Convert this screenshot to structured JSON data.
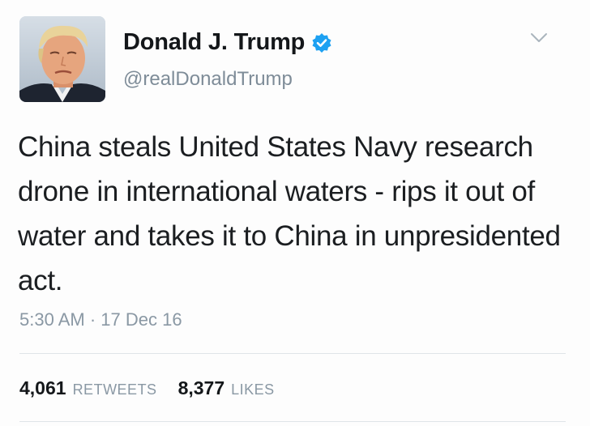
{
  "tweet": {
    "author": {
      "display_name": "Donald J. Trump",
      "handle": "@realDonaldTrump",
      "verified": true,
      "verified_color": "#1da1f2"
    },
    "text": "China steals United States Navy research drone in international waters - rips it out of water and takes it to China in unpresidented act.",
    "timestamp": "5:30 AM · 17 Dec 16",
    "stats": {
      "retweets_count": "4,061",
      "retweets_label": "RETWEETS",
      "likes_count": "8,377",
      "likes_label": "LIKES"
    },
    "menu_icon": "chevron-down-icon"
  }
}
